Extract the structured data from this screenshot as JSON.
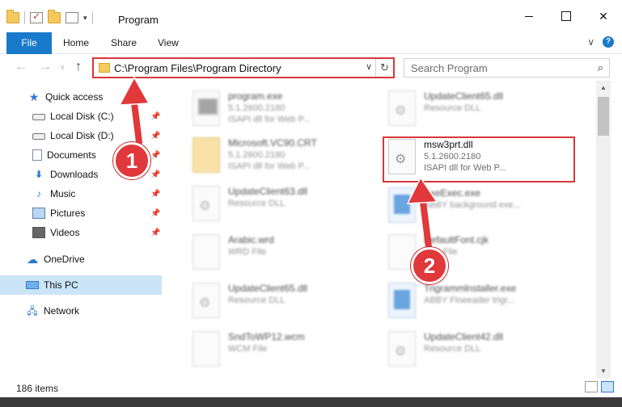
{
  "window": {
    "title": "Program"
  },
  "ribbon": {
    "tabs": [
      "File",
      "Home",
      "Share",
      "View"
    ]
  },
  "address": {
    "path": "C:\\Program Files\\Program Directory"
  },
  "search": {
    "placeholder": "Search Program"
  },
  "sidebar": {
    "quick_access": "Quick access",
    "items": [
      {
        "label": "Local Disk (C:)",
        "icon": "disk-icon"
      },
      {
        "label": "Local Disk (D:)",
        "icon": "disk-icon"
      },
      {
        "label": "Documents",
        "icon": "documents-icon"
      },
      {
        "label": "Downloads",
        "icon": "download-icon"
      },
      {
        "label": "Music",
        "icon": "music-icon"
      },
      {
        "label": "Pictures",
        "icon": "pictures-icon"
      },
      {
        "label": "Videos",
        "icon": "videos-icon"
      }
    ],
    "onedrive": "OneDrive",
    "this_pc": "This PC",
    "network": "Network"
  },
  "files": {
    "left": [
      {
        "name": "program.exe",
        "line1": "5.1.2600.2180",
        "line2": "ISAPI dll for Web P...",
        "icon": "exe-icon"
      },
      {
        "name": "Microsoft.VC90.CRT",
        "line1": "5.1.2600.2180",
        "line2": "ISAPI dll for Web P...",
        "icon": "folder-icon"
      },
      {
        "name": "UpdateClient63.dll",
        "line1": "Resource DLL",
        "line2": "",
        "icon": "dll-icon"
      },
      {
        "name": "Arabic.wrd",
        "line1": "WRD File",
        "line2": "",
        "icon": "file-icon"
      },
      {
        "name": "UpdateClient65.dll",
        "line1": "Resource DLL",
        "line2": "",
        "icon": "dll-icon"
      },
      {
        "name": "SndToWP12.wcm",
        "line1": "WCM File",
        "line2": "",
        "icon": "file-icon"
      }
    ],
    "right": [
      {
        "name": "UpdateClient65.dll",
        "line1": "Resource DLL",
        "line2": "",
        "icon": "dll-icon"
      },
      {
        "name": "msw3prt.dll",
        "line1": "5.1.2600.2180",
        "line2": "ISAPI dll for Web P...",
        "icon": "dll-icon"
      },
      {
        "name": "ExeExec.exe",
        "line1": "ABBY background exe...",
        "line2": "",
        "icon": "app-icon"
      },
      {
        "name": "DefaultFont.cjk",
        "line1": "CJK File",
        "line2": "",
        "icon": "file-icon"
      },
      {
        "name": "Trigrammlnstaller.exe",
        "line1": "ABBY Fineeader trigr...",
        "line2": "",
        "icon": "app-icon"
      },
      {
        "name": "UpdateClient42.dll",
        "line1": "Resource DLL",
        "line2": "",
        "icon": "dll-icon"
      }
    ]
  },
  "status": {
    "item_count": "186 items"
  },
  "callouts": [
    "1",
    "2"
  ],
  "colors": {
    "accent": "#1979ca",
    "highlight": "#d9373a",
    "selected": "#cce4f7"
  }
}
